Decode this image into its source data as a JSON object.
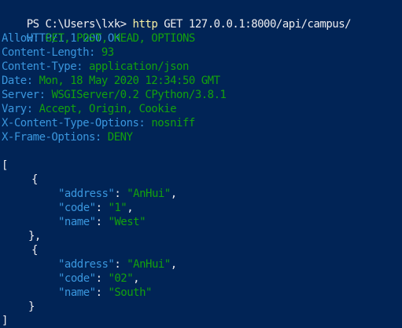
{
  "prompt": {
    "ps": "PS",
    "path": "C:\\Users\\lxk>",
    "command": "http",
    "args": "GET 127.0.0.1:8000/api/campus/"
  },
  "response": {
    "status_line": {
      "protocol": "HTTP/1.1",
      "code": "200",
      "reason": "OK"
    },
    "headers": [
      {
        "name": "Allow:",
        "value": "GET, POST, HEAD, OPTIONS"
      },
      {
        "name": "Content-Length:",
        "value": "93"
      },
      {
        "name": "Content-Type:",
        "value": "application/json"
      },
      {
        "name": "Date:",
        "value": "Mon, 18 May 2020 12:34:50 GMT"
      },
      {
        "name": "Server:",
        "value": "WSGIServer/0.2 CPython/3.8.1"
      },
      {
        "name": "Vary:",
        "value": "Accept, Origin, Cookie"
      },
      {
        "name": "X-Content-Type-Options:",
        "value": "nosniff"
      },
      {
        "name": "X-Frame-Options:",
        "value": "DENY"
      }
    ]
  },
  "body": {
    "open_bracket": "[",
    "records": [
      {
        "open": "{",
        "fields": [
          {
            "key": "\"address\"",
            "value": "\"AnHui\"",
            "sep": ",",
            "colon": ":"
          },
          {
            "key": "\"code\"",
            "value": "\"1\"",
            "sep": ",",
            "colon": ":"
          },
          {
            "key": "\"name\"",
            "value": "\"West\"",
            "sep": "",
            "colon": ":"
          }
        ],
        "close": "},"
      },
      {
        "open": "{",
        "fields": [
          {
            "key": "\"address\"",
            "value": "\"AnHui\"",
            "sep": ",",
            "colon": ":"
          },
          {
            "key": "\"code\"",
            "value": "\"02\"",
            "sep": ",",
            "colon": ":"
          },
          {
            "key": "\"name\"",
            "value": "\"South\"",
            "sep": "",
            "colon": ":"
          }
        ],
        "close": "}"
      }
    ],
    "close_bracket": "]"
  },
  "colors": {
    "background": "#012456",
    "text": "#eeedf0",
    "command": "#f9f1a5",
    "value": "#13a10e",
    "key": "#3a96dd"
  }
}
